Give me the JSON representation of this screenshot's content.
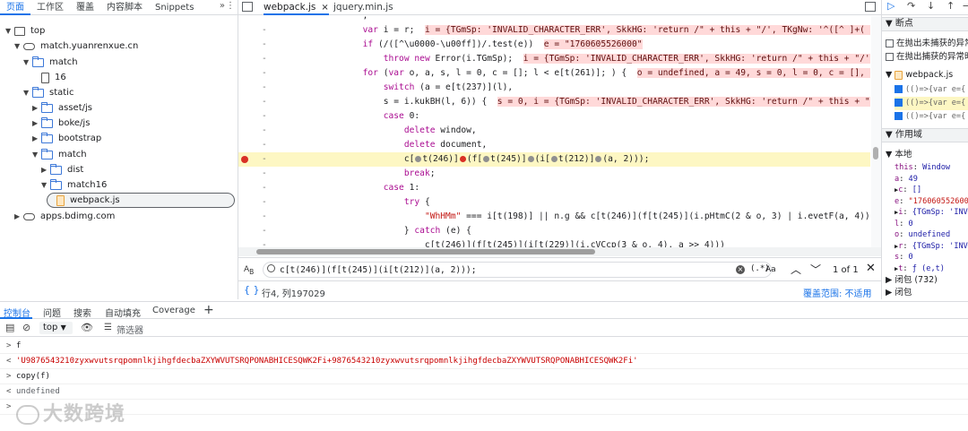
{
  "nav": {
    "tabs": [
      "页面",
      "工作区",
      "覆盖",
      "内容脚本",
      "Snippets"
    ]
  },
  "tree": {
    "nodes": [
      {
        "label": "top",
        "icon": "frame-icon"
      },
      {
        "label": "match.yuanrenxue.cn",
        "icon": "cloud-icon"
      },
      {
        "label": "match",
        "icon": "folder-icon"
      },
      {
        "label": "16",
        "icon": "file-icon"
      },
      {
        "label": "static",
        "icon": "folder-icon"
      },
      {
        "label": "asset/js",
        "icon": "folder-icon"
      },
      {
        "label": "boke/js",
        "icon": "folder-icon"
      },
      {
        "label": "bootstrap",
        "icon": "folder-icon"
      },
      {
        "label": "match",
        "icon": "folder-icon"
      },
      {
        "label": "dist",
        "icon": "folder-icon"
      },
      {
        "label": "match16",
        "icon": "folder-icon"
      },
      {
        "label": "webpack.js",
        "icon": "js-file-icon"
      },
      {
        "label": "apps.bdimg.com",
        "icon": "cloud-icon"
      }
    ]
  },
  "editor": {
    "tabs": [
      {
        "label": "webpack.js",
        "close": "×"
      },
      {
        "label": "jquery.min.js"
      }
    ]
  },
  "code": {
    "lines": [
      {
        "t": "                        ,",
        "i": ""
      },
      {
        "t": "                        var i = r;",
        "i": "i = {TGmSp: 'INVALID_CHARACTER_ERR', SkkHG: 'return /\" + this + \"/', TKgNw: '^([^ ]+( +[^ ]+)+)+[^ ]}'"
      },
      {
        "t": "                        if (/([^\\u0000-\\u00ff])/.test(e))",
        "i": "e = \"1760605526000\""
      },
      {
        "t": "                            throw new Error(i.TGmSp);",
        "i": "i = {TGmSp: 'INVALID_CHARACTER_ERR', SkkHG: 'return /\" + this + \"/', TKgNw: '^('"
      },
      {
        "t": "                        for (var o, a, s, l = 0, c = []; l < e[t(261)]; ) {",
        "i": "o = undefined, a = 49, s = 0, l = 0, c = [], e = \"1760605\""
      },
      {
        "t": "                            switch (a = e[t(237)](l),",
        "i": ""
      },
      {
        "t": "                            s = i.kukBH(l, 6)) {",
        "i": "s = 0, i = {TGmSp: 'INVALID_CHARACTER_ERR', SkkHG: 'return /\" + this + \"/', TKgNw: '"
      },
      {
        "t": "                            case 0:",
        "i": ""
      },
      {
        "t": "                                delete window,",
        "i": ""
      },
      {
        "t": "                                delete document,",
        "i": ""
      },
      {
        "t": "                                c[",
        "i": "",
        "hl": true
      },
      {
        "t": "                                break;",
        "i": ""
      },
      {
        "t": "                            case 1:",
        "i": ""
      },
      {
        "t": "                                try {",
        "i": ""
      },
      {
        "t": "                                    \"WhHMm\" === i[t(198)] || n.g && c[t(246)](f[t(245)](i.pHtmC(2 & o, 3) | i.evetF(a, 4)))",
        "i": ""
      },
      {
        "t": "                                } catch (e) {",
        "i": ""
      },
      {
        "t": "                                    c[t(246)](f[t(245)](i[t(229)](i.cVCcp(3 & o, 4), a >> 4)))",
        "i": ""
      },
      {
        "t": "                                }",
        "i": ""
      },
      {
        "t": "                                break;",
        "i": ""
      },
      {
        "t": "                            case 2:",
        "i": ""
      }
    ],
    "bp_line": "c[●t(246)]●(f[●t(245)]●(i[●t(212)]●(a, 2)));"
  },
  "search": {
    "query": "c[t(246)](f[t(245)](i[t(212)](a, 2)));",
    "regex": "(.*)",
    "case": "Aa",
    "count": "1 of 1"
  },
  "status": {
    "braces": "{ }",
    "position": "行4, 列197029",
    "coverage": "覆盖范围: 不适用"
  },
  "right": {
    "breakpoints_title": "断点",
    "pause_uncaught": "在抛出未捕获的异常时暂停",
    "pause_caught": "在抛出捕获的异常时暂停",
    "file": "webpack.js",
    "bps": [
      "(()=>{var e={",
      "(()=>{var e={",
      "(()=>{var e={"
    ],
    "scope_title": "作用域",
    "local": "本地",
    "vars": [
      {
        "k": "this",
        "v": "Window"
      },
      {
        "k": "a",
        "v": "49"
      },
      {
        "k": "c",
        "v": "[]"
      },
      {
        "k": "e",
        "v": "\"1760605526000\""
      },
      {
        "k": "i",
        "v": "{TGmSp: 'INVALID_CHARACTER_ERR'"
      },
      {
        "k": "l",
        "v": "0"
      },
      {
        "k": "o",
        "v": "undefined"
      },
      {
        "k": "r",
        "v": "{TGmSp: 'INVALID_CHARACTER_ERR'"
      },
      {
        "k": "s",
        "v": "0"
      },
      {
        "k": "t",
        "v": "ƒ (e,t)"
      }
    ],
    "closure": "闭包 (732)",
    "closure2": "闭包"
  },
  "console": {
    "tabs": [
      "控制台",
      "问题",
      "搜索",
      "自动填充",
      "Coverage"
    ],
    "context": "top",
    "filter": "筛选器",
    "lines": [
      {
        "prompt": ">",
        "text": "f",
        "cls": ""
      },
      {
        "prompt": "<",
        "text": "'U9876543210zyxwvutsrqpomnlkjihgfdecbaZXYWVUTSRQPONABHICESQWK2Fi+9876543210zyxwvutsrqpomnlkjihgfdecbaZXYWVUTSRQPONABHICESQWK2Fi'",
        "cls": "res"
      },
      {
        "prompt": ">",
        "text": "copy(f)",
        "cls": ""
      },
      {
        "prompt": "<",
        "text": "undefined",
        "cls": "undef"
      },
      {
        "prompt": ">",
        "text": "",
        "cls": ""
      }
    ]
  },
  "watermark": "大数跨境"
}
